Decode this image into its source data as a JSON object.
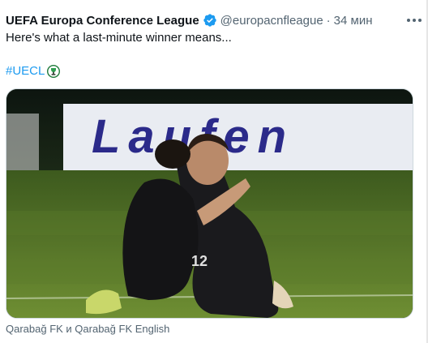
{
  "tweet": {
    "author_name": "UEFA Europa Conference League",
    "handle": "@europacnfleague",
    "separator": "·",
    "time": "34 мин",
    "text": "Here's what a last-minute winner means...",
    "hashtag": "#UECL",
    "media": {
      "banner_text": "Laufen",
      "player_number": "12"
    },
    "tagged_users": "Qarabağ FK и Qarabağ FK English"
  },
  "colors": {
    "accent": "#1d9bf0",
    "text_primary": "#0f1419",
    "text_secondary": "#536471"
  },
  "icons": {
    "verified": "verified-badge-icon",
    "more": "more-options-icon",
    "uecl": "uecl-trophy-icon"
  }
}
